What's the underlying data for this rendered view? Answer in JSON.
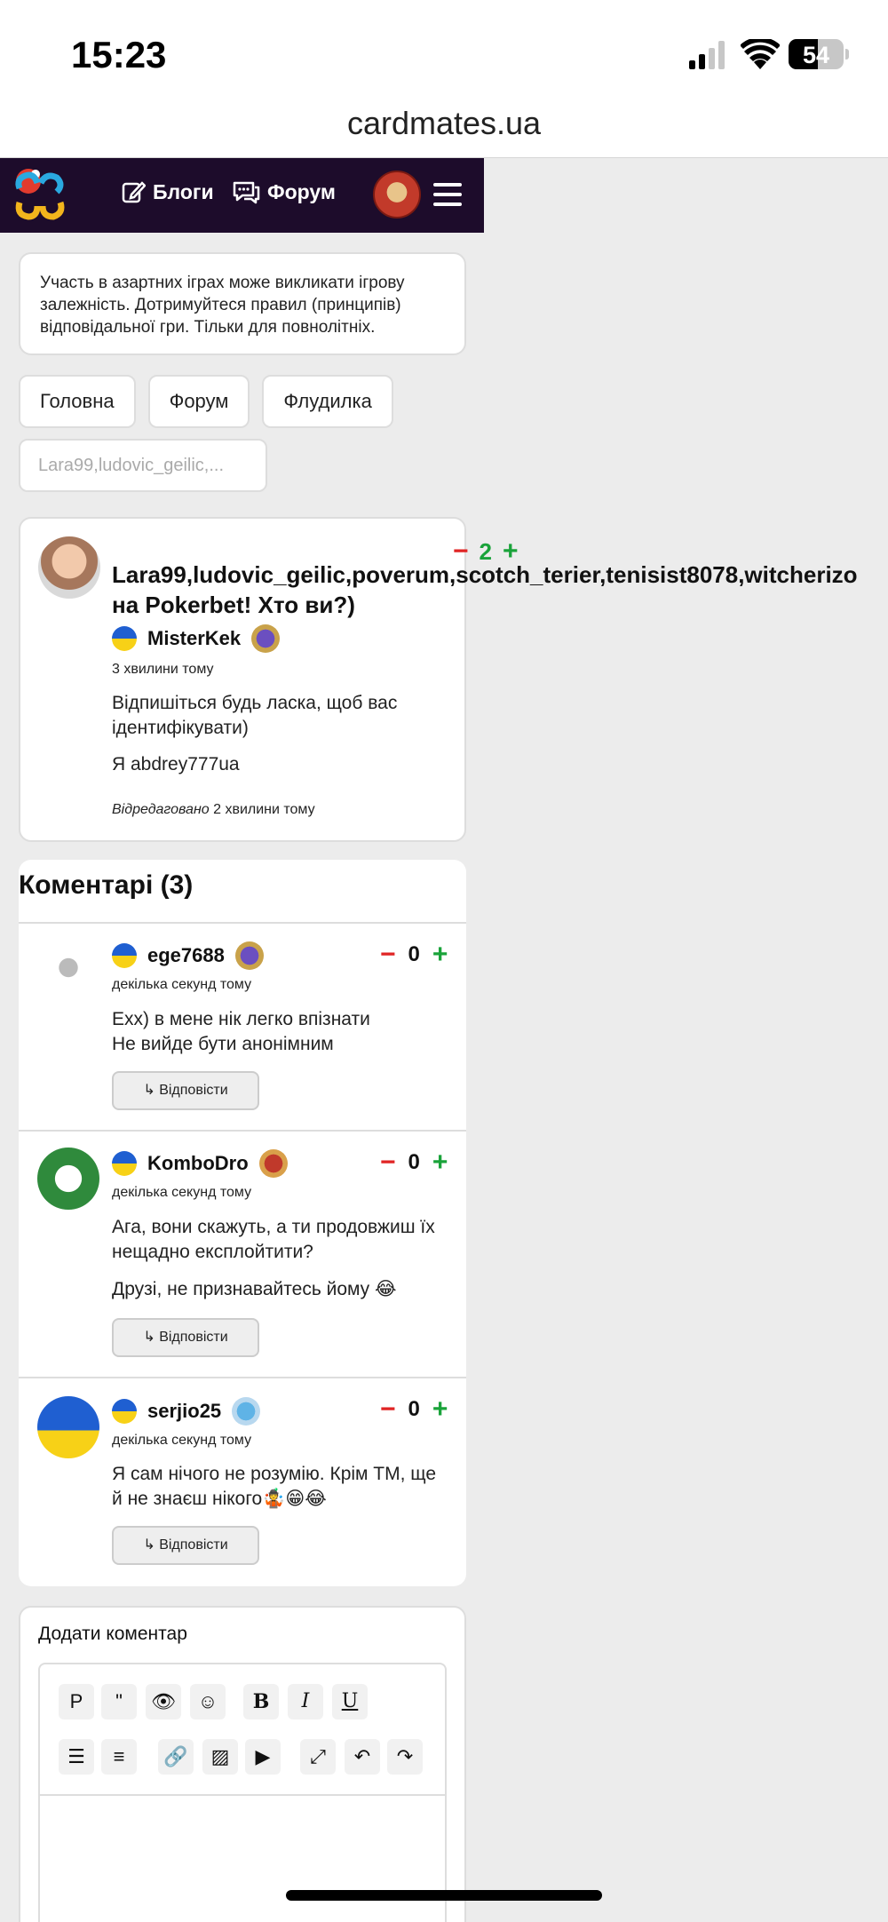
{
  "status_bar": {
    "time": "15:23",
    "battery": "54"
  },
  "url_bar": {
    "domain": "cardmates.ua"
  },
  "nav": {
    "blogs_label": "Блоги",
    "forum_label": "Форум"
  },
  "notice": {
    "text": "Участь в азартних іграх може викликати ігрову залежність. Дотримуйтеся правил (принципів) відповідальної гри. Тільки для повнолітніх."
  },
  "breadcrumbs": {
    "items": [
      "Головна",
      "Форум",
      "Флудилка"
    ],
    "current": "Lara99,ludovic_geilic,..."
  },
  "post": {
    "votes": "2",
    "title_line1": "Lara99,ludovic_geilic,poverum,scotch_terier,tenisist8078,witcherizo",
    "title_line2": "на Pokerbet! Хто ви?)",
    "author": "MisterKek",
    "time": "3 хвилини тому",
    "body1": "Відпишіться будь ласка, щоб вас ідентифікувати)",
    "body2": "Я abdrey777ua",
    "edited_label": "Відредаговано",
    "edited_time": "2 хвилини тому"
  },
  "comments": {
    "title": "Коментарі (3)",
    "reply_label": "↳ Відповісти",
    "items": [
      {
        "author": "ege7688",
        "time": "декілька секунд тому",
        "votes": "0",
        "text1": "Exx) в мене нік легко впізнати",
        "text2": "Не вийде бути анонімним"
      },
      {
        "author": "KomboDro",
        "time": "декілька секунд тому",
        "votes": "0",
        "text1": "Ага, вони скажуть, а ти продовжиш їх нещадно експлойтити?",
        "text2": "Друзі, не признавайтесь йому 😂"
      },
      {
        "author": "serjio25",
        "time": "декілька секунд тому",
        "votes": "0",
        "text1": "Я сам нічого не розумію. Крім ТМ, ще й не знаєш нікого🤹😁😂"
      }
    ]
  },
  "add_comment": {
    "title": "Додати коментар",
    "toolbar_row1": [
      "P",
      "\"",
      "👁",
      "☺",
      "B",
      "I",
      "U"
    ],
    "toolbar_row2": [
      "☰",
      "≡",
      "🔗",
      "▨",
      "▶",
      "⤢",
      "↶",
      "↷"
    ]
  }
}
